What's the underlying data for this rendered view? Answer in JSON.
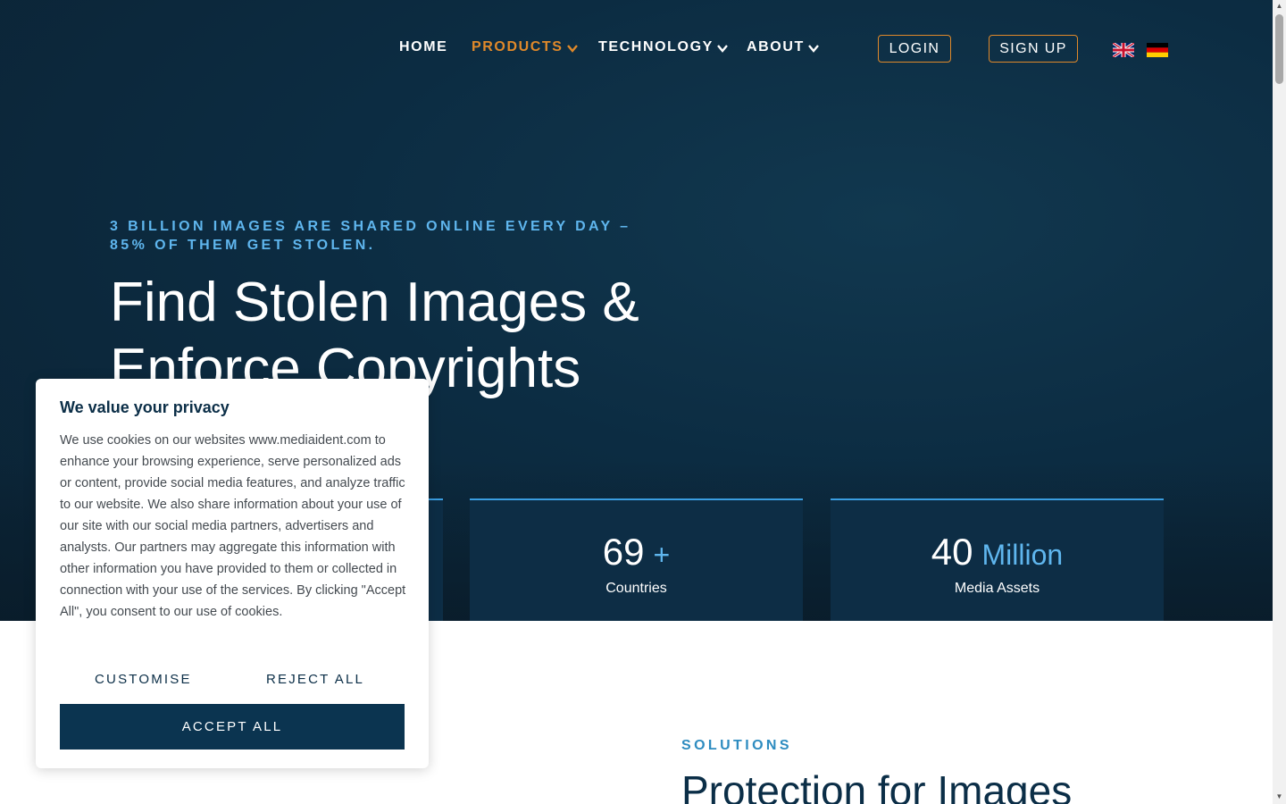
{
  "nav": {
    "items": [
      {
        "label": "HOME",
        "has_dropdown": false
      },
      {
        "label": "PRODUCTS",
        "has_dropdown": true,
        "active": true
      },
      {
        "label": "TECHNOLOGY",
        "has_dropdown": true
      },
      {
        "label": "ABOUT",
        "has_dropdown": true
      }
    ],
    "login_label": "LOGIN",
    "signup_label": "SIGN UP",
    "languages": [
      "en-flag-icon",
      "de-flag-icon"
    ]
  },
  "hero": {
    "kicker": "3 BILLION IMAGES ARE SHARED ONLINE EVERY DAY – 85% OF THEM GET STOLEN.",
    "headline": "Find Stolen Images & Enforce Copyrights"
  },
  "stats": [
    {
      "number": "",
      "suffix": "",
      "label": ""
    },
    {
      "number": "69",
      "suffix": "+",
      "label": "Countries"
    },
    {
      "number": "40",
      "suffix": "Million",
      "label": "Media Assets"
    }
  ],
  "solutions": {
    "kicker": "SOLUTIONS",
    "title": "Protection for Images"
  },
  "cookie": {
    "title": "We value your privacy",
    "text": "We use cookies on our websites www.mediaident.com to enhance your browsing experience, serve personalized ads or content, provide social media features, and analyze traffic to our website. We also share information about your use of our site with our social media partners, advertisers and analysts. Our partners may aggregate this information with other information you have provided to them or collected in connection with your use of the services. By clicking \"Accept All\", you consent to our use of cookies.",
    "customise_label": "CUSTOMISE",
    "reject_label": "REJECT ALL",
    "accept_label": "ACCEPT ALL"
  },
  "colors": {
    "accent_orange": "#e0892a",
    "light_blue": "#5fb6ee",
    "navy": "#0b3450"
  }
}
